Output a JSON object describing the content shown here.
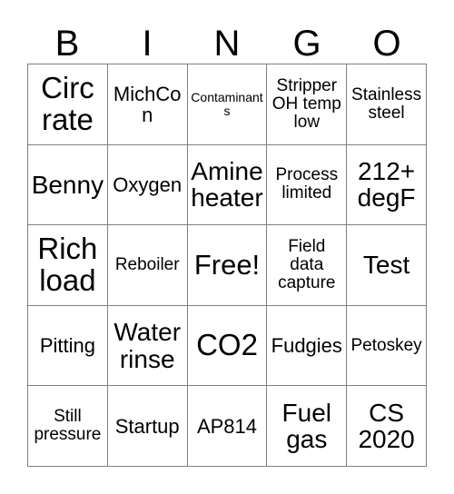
{
  "card": {
    "headers": [
      "B",
      "I",
      "N",
      "G",
      "O"
    ],
    "rows": [
      [
        {
          "text": "Circ rate",
          "size": "xl"
        },
        {
          "text": "MichCon",
          "size": "md"
        },
        {
          "text": "Contaminants",
          "size": "xs"
        },
        {
          "text": "Stripper OH temp low",
          "size": "sm"
        },
        {
          "text": "Stainless steel",
          "size": "sm"
        }
      ],
      [
        {
          "text": "Benny",
          "size": "lg"
        },
        {
          "text": "Oxygen",
          "size": "md"
        },
        {
          "text": "Amine heater",
          "size": "lg"
        },
        {
          "text": "Process limited",
          "size": "sm"
        },
        {
          "text": "212+ degF",
          "size": "lg"
        }
      ],
      [
        {
          "text": "Rich load",
          "size": "xl"
        },
        {
          "text": "Reboiler",
          "size": "sm"
        },
        {
          "text": "Free!",
          "size": "free"
        },
        {
          "text": "Field data capture",
          "size": "sm"
        },
        {
          "text": "Test",
          "size": "lg"
        }
      ],
      [
        {
          "text": "Pitting",
          "size": "md"
        },
        {
          "text": "Water rinse",
          "size": "lg"
        },
        {
          "text": "CO2",
          "size": "xl"
        },
        {
          "text": "Fudgies",
          "size": "md"
        },
        {
          "text": "Petoskey",
          "size": "sm"
        }
      ],
      [
        {
          "text": "Still pressure",
          "size": "sm"
        },
        {
          "text": "Startup",
          "size": "md"
        },
        {
          "text": "AP814",
          "size": "md"
        },
        {
          "text": "Fuel gas",
          "size": "lg"
        },
        {
          "text": "CS 2020",
          "size": "lg"
        }
      ]
    ]
  },
  "style": {
    "border_color": "#808080",
    "text_color": "#000000",
    "background": "#ffffff"
  }
}
